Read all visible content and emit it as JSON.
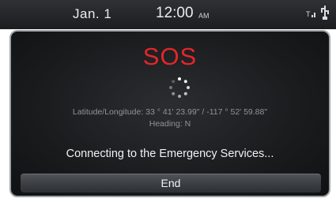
{
  "status_bar": {
    "date": "Jan.  1",
    "time": "12:00",
    "ampm": "AM",
    "icons": [
      "signal-icon",
      "usb-icon"
    ]
  },
  "dialog": {
    "title": "SOS",
    "spinner_icon": "loading-spinner-icon",
    "location_text": "Latitude/Longitude: 33 ° 41' 23.99\" / -117 ° 52' 59.88\"",
    "heading_text": "Heading: N",
    "status_message": "Connecting to the Emergency Services...",
    "end_label": "End"
  },
  "colors": {
    "sos_red": "#e5262b",
    "status_bar_bg": "#1b1d20",
    "dialog_bg": "#1a1b1d",
    "muted_text": "#8e949a"
  }
}
